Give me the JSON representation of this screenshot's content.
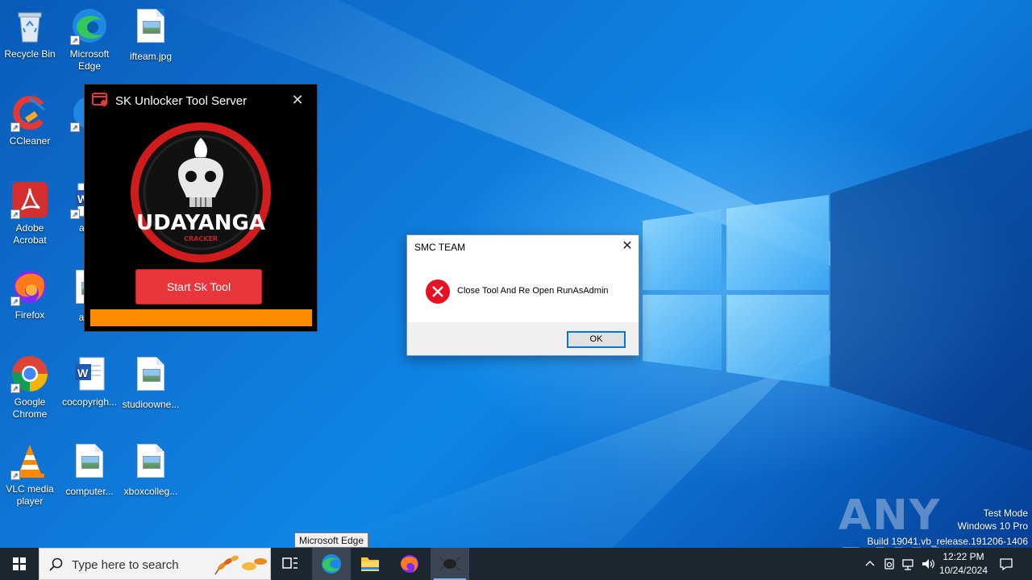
{
  "desktop": {
    "icons": [
      {
        "label": "Recycle Bin",
        "icon": "recycle-bin-icon"
      },
      {
        "label": "Microsoft Edge",
        "icon": "edge-icon"
      },
      {
        "label": "ifteam.jpg",
        "icon": "image-file-icon"
      },
      {
        "label": "CCleaner",
        "icon": "ccleaner-icon"
      },
      {
        "label": "S",
        "icon": "edge-icon"
      },
      {
        "label": "Adobe Acrobat",
        "icon": "acrobat-icon"
      },
      {
        "label": "abov",
        "icon": "word-doc-icon"
      },
      {
        "label": "Firefox",
        "icon": "firefox-icon"
      },
      {
        "label": "austr",
        "icon": "image-file-icon"
      },
      {
        "label": "Google Chrome",
        "icon": "chrome-icon"
      },
      {
        "label": "cocopyrigh...",
        "icon": "word-doc-icon"
      },
      {
        "label": "studioowne...",
        "icon": "image-file-icon"
      },
      {
        "label": "VLC media player",
        "icon": "vlc-icon"
      },
      {
        "label": "computer...",
        "icon": "image-file-icon"
      },
      {
        "label": "xboxcolleg...",
        "icon": "image-file-icon"
      }
    ]
  },
  "sk_window": {
    "title": "SK Unlocker Tool Server",
    "logo_text": "UDAYANGA",
    "logo_subtext": "CRACKER",
    "start_button": "Start Sk Tool",
    "progress_color": "#ff8c00",
    "button_color": "#e8363c"
  },
  "msgbox": {
    "title": "SMC TEAM",
    "message": "Close Tool And Re Open RunAsAdmin",
    "ok_label": "OK"
  },
  "tooltip": "Microsoft Edge",
  "watermark": {
    "brand": "ANY RUN",
    "line1": "Test Mode",
    "line2": "Windows 10 Pro",
    "line3": "Build 19041.vb_release.191206-1406"
  },
  "taskbar": {
    "search_placeholder": "Type here to search",
    "time": "12:22 PM",
    "date": "10/24/2024",
    "apps": [
      "task-view-icon",
      "edge-icon",
      "file-explorer-icon",
      "firefox-icon",
      "sk-unlocker-icon"
    ]
  }
}
